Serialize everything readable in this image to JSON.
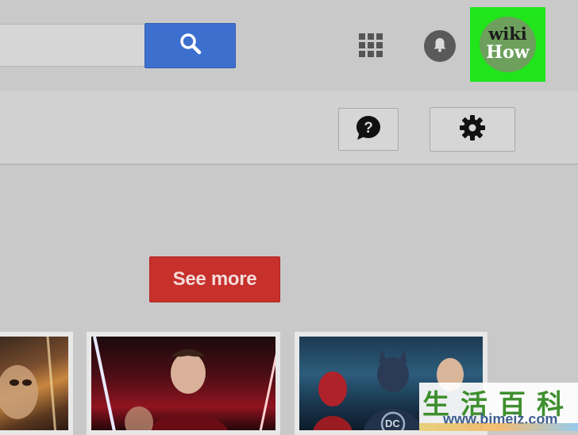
{
  "header": {
    "search": {
      "value": "",
      "placeholder": ""
    },
    "search_button_icon": "search-icon",
    "apps_icon": "grid-apps-icon",
    "notifications_icon": "bell-icon",
    "avatar": {
      "line1": "wiki",
      "line2": "How"
    },
    "highlight_color": "#1fe51a"
  },
  "toolbar": {
    "help_icon": "help-bubble-icon",
    "settings_icon": "gear-icon"
  },
  "main": {
    "see_more_label": "See more",
    "see_more_color": "#c7302b"
  },
  "thumbnails": [
    {
      "name": "movie-thumbnail-1"
    },
    {
      "name": "movie-thumbnail-2"
    },
    {
      "name": "movie-thumbnail-3",
      "badge": "DC"
    }
  ],
  "watermark": {
    "chars": "生活百科",
    "url": "www.bimeiz.com"
  }
}
